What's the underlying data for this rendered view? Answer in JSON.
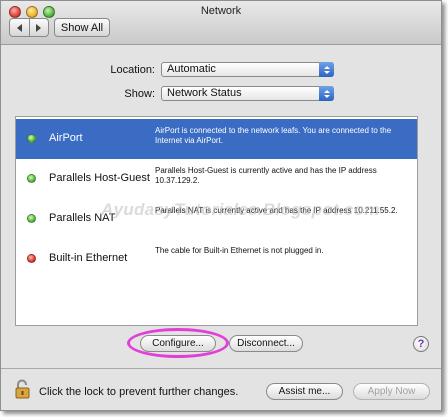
{
  "window": {
    "title": "Network"
  },
  "toolbar": {
    "back_icon": "triangle-left",
    "forward_icon": "triangle-right",
    "show_all_label": "Show All"
  },
  "location": {
    "label": "Location:",
    "value": "Automatic"
  },
  "show": {
    "label": "Show:",
    "value": "Network Status"
  },
  "connections": [
    {
      "name": "AirPort",
      "status": "green",
      "description": "AirPort is connected to the network leafs. You are connected to the Internet via AirPort.",
      "selected": true
    },
    {
      "name": "Parallels Host-Guest",
      "status": "green",
      "description": "Parallels Host-Guest is currently active and has the IP address 10.37.129.2.",
      "selected": false
    },
    {
      "name": "Parallels NAT",
      "status": "green",
      "description": "Parallels NAT is currently active and has the IP address 10.211.55.2.",
      "selected": false
    },
    {
      "name": "Built-in Ethernet",
      "status": "red",
      "description": "The cable for Built-in Ethernet is not plugged in.",
      "selected": false
    }
  ],
  "watermark": "AyudasyTutoriales.Blogspot.com",
  "buttons": {
    "configure": "Configure...",
    "disconnect": "Disconnect...",
    "help": "?",
    "assist_me": "Assist me...",
    "apply_now": "Apply Now"
  },
  "lock": {
    "text": "Click the lock to prevent further changes.",
    "icon": "unlocked-padlock"
  },
  "colors": {
    "selection": "#3a6cc4",
    "highlight_circle": "#e23fd9",
    "popup_accent": "#2d63c4"
  }
}
